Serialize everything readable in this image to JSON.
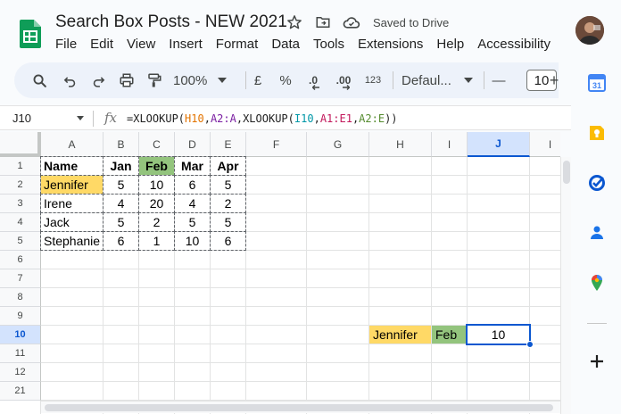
{
  "header": {
    "doc_title": "Search Box Posts - NEW 2021",
    "saved_status": "Saved to Drive"
  },
  "menu": [
    "File",
    "Edit",
    "View",
    "Insert",
    "Format",
    "Data",
    "Tools",
    "Extensions",
    "Help",
    "Accessibility"
  ],
  "toolbar": {
    "zoom": "100%",
    "currency": "£",
    "percent": "%",
    "dec_decrease": ".0",
    "dec_increase": ".00",
    "number_format": "123",
    "font_name": "Defaul...",
    "font_size": "10",
    "minus": "—",
    "plus": "+"
  },
  "formula_bar": {
    "name_box": "J10",
    "fx": "fx",
    "formula_parts": [
      {
        "t": "=XLOOKUP(",
        "c": "#1f1f1f"
      },
      {
        "t": "H10",
        "c": "#e37400"
      },
      {
        "t": ",",
        "c": "#1f1f1f"
      },
      {
        "t": "A2:A",
        "c": "#7b1fa2"
      },
      {
        "t": ",XLOOKUP(",
        "c": "#1f1f1f"
      },
      {
        "t": "I10",
        "c": "#0097a7"
      },
      {
        "t": ",",
        "c": "#1f1f1f"
      },
      {
        "t": "A1:E1",
        "c": "#c2185b"
      },
      {
        "t": ",",
        "c": "#1f1f1f"
      },
      {
        "t": "A2:E",
        "c": "#558b2f"
      },
      {
        "t": "))",
        "c": "#1f1f1f"
      }
    ]
  },
  "grid": {
    "columns": [
      "A",
      "B",
      "C",
      "D",
      "E",
      "F",
      "G",
      "H",
      "I",
      "J",
      "I"
    ],
    "rows": [
      "1",
      "2",
      "3",
      "4",
      "5",
      "6",
      "7",
      "8",
      "9",
      "10",
      "11",
      "12",
      "21"
    ],
    "selected_column": "J",
    "selected_row": "10",
    "table_header": [
      "Name",
      "Jan",
      "Feb",
      "Mar",
      "Apr"
    ],
    "table_rows": [
      [
        "Jennifer",
        "5",
        "10",
        "6",
        "5"
      ],
      [
        "Irene",
        "4",
        "20",
        "4",
        "2"
      ],
      [
        "Jack",
        "5",
        "2",
        "5",
        "5"
      ],
      [
        "Stephanie",
        "6",
        "1",
        "10",
        "6"
      ]
    ],
    "lookup_name": "Jennifer",
    "lookup_month": "Feb",
    "result": "10"
  },
  "colors": {
    "highlight_yellow": "#ffd966",
    "highlight_green": "#93c47d",
    "selection_blue": "#0b57d0",
    "sheets_green": "#0f9d58"
  },
  "side_panel_icons": [
    "calendar-icon",
    "keep-icon",
    "tasks-icon",
    "contacts-icon",
    "maps-icon",
    "add-icon"
  ]
}
